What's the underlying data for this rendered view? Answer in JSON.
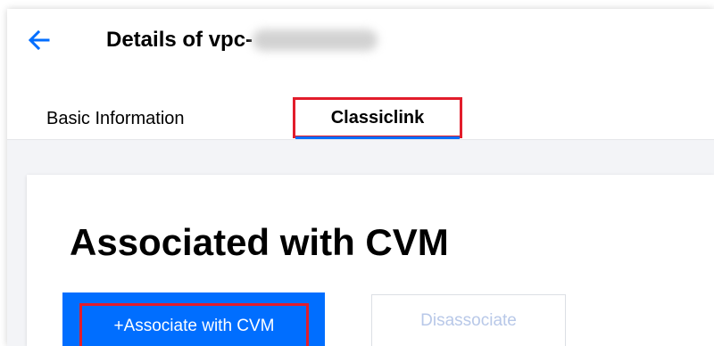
{
  "header": {
    "back_icon": "arrow-left-icon",
    "title": "Details of vpc-",
    "title_redacted": true
  },
  "tabs": [
    {
      "label": "Basic Information",
      "active": false
    },
    {
      "label": "Classiclink",
      "active": true,
      "highlighted": true
    }
  ],
  "section": {
    "title": "Associated with CVM"
  },
  "actions": {
    "associate_label": "+Associate with CVM",
    "disassociate_label": "Disassociate",
    "disassociate_disabled": true
  },
  "colors": {
    "accent": "#006eff",
    "highlight": "#e21d2b",
    "disabled_text": "#b8c8e8",
    "page_background": "#f3f4f7"
  }
}
